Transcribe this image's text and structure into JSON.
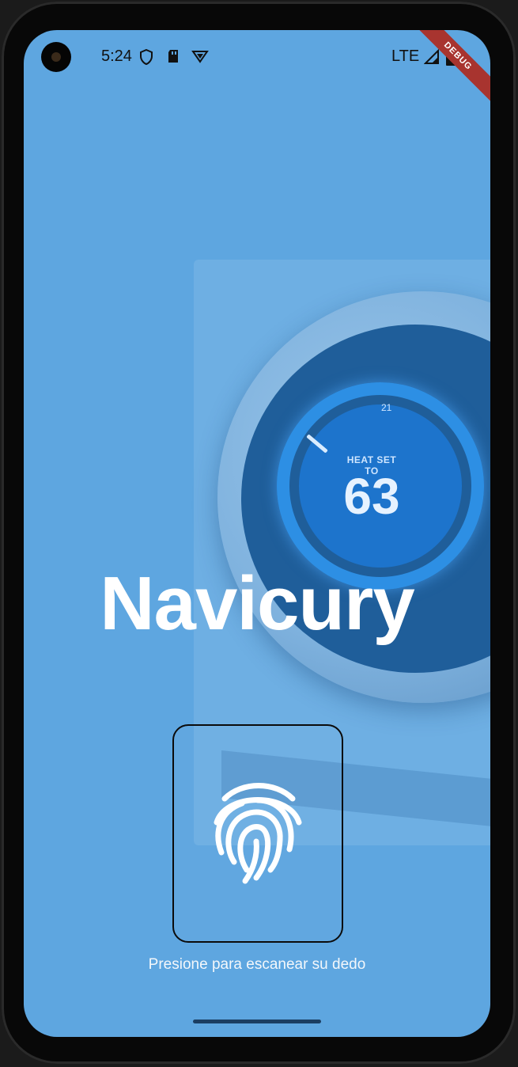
{
  "status_bar": {
    "time": "5:24",
    "network": "LTE",
    "icons": [
      "shield-icon",
      "sd-card-icon",
      "vpn-icon",
      "signal-icon",
      "battery-icon"
    ],
    "debug_banner": "DEBUG"
  },
  "background": {
    "thermostat_label": "HEAT SET TO",
    "thermostat_value": "63",
    "thermostat_small": "21"
  },
  "app": {
    "title": "Navicury",
    "fingerprint_hint": "Presione para escanear su dedo",
    "fingerprint_icon": "fingerprint-icon"
  },
  "colors": {
    "background_overlay": "#5ea6e0",
    "title": "#ffffff",
    "button_border": "#0b0b0b",
    "debug_ribbon": "#a8342f"
  }
}
